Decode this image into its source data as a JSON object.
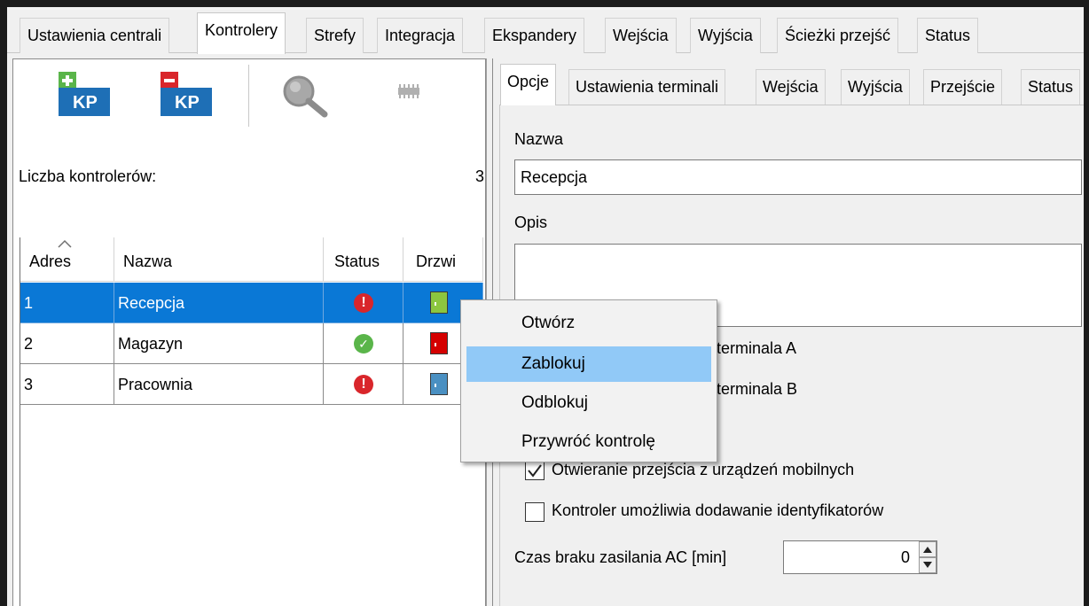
{
  "main_tabs": [
    {
      "label": "Ustawienia centrali"
    },
    {
      "label": "Kontrolery",
      "active": true
    },
    {
      "label": "Strefy"
    },
    {
      "label": "Integracja"
    },
    {
      "label": "Ekspandery"
    },
    {
      "label": "Wejścia"
    },
    {
      "label": "Wyjścia"
    },
    {
      "label": "Ścieżki przejść"
    },
    {
      "label": "Status"
    }
  ],
  "toolbar": {
    "add_icon_text": "KP",
    "remove_icon_text": "KP",
    "add_icon": "add-keypad-icon",
    "remove_icon": "remove-keypad-icon",
    "search_icon": "search-icon",
    "device_icon": "device-module-icon",
    "add_color": "#5ab54a",
    "remove_color": "#d9262b",
    "kp_color": "#1e6fb6"
  },
  "controllers": {
    "count_label": "Liczba kontrolerów:",
    "count_value": "3",
    "columns": [
      "Adres",
      "Nazwa",
      "Status",
      "Drzwi"
    ],
    "rows": [
      {
        "address": "1",
        "name": "Recepcja",
        "status": "error",
        "door": "green",
        "selected": true
      },
      {
        "address": "2",
        "name": "Magazyn",
        "status": "ok",
        "door": "red"
      },
      {
        "address": "3",
        "name": "Pracownia",
        "status": "error",
        "door": "blue"
      }
    ]
  },
  "status_glyphs": {
    "error": "!",
    "ok": "✓"
  },
  "colors": {
    "selection": "#0a78d6",
    "door_green": "#8cc63f",
    "door_red": "#d40000",
    "door_blue": "#4a90c2",
    "status_error": "#d9262b",
    "status_ok": "#5ab54a"
  },
  "sub_tabs": [
    {
      "label": "Opcje",
      "active": true
    },
    {
      "label": "Ustawienia terminali"
    },
    {
      "label": "Wejścia"
    },
    {
      "label": "Wyjścia"
    },
    {
      "label": "Przejście"
    },
    {
      "label": "Status"
    }
  ],
  "options": {
    "name_label": "Nazwa",
    "name_value": "Recepcja",
    "desc_label": "Opis",
    "desc_value": "",
    "terminal_a_tail": "terminala A",
    "terminal_b_tail": "terminala B",
    "mobile_label": "Otwieranie przejścia z urządzeń mobilnych",
    "mobile_checked": true,
    "ids_label": "Kontroler umożliwia dodawanie identyfikatorów",
    "ids_checked": false,
    "ac_label": "Czas braku zasilania AC [min]",
    "ac_value": "0"
  },
  "context_menu": {
    "items": [
      {
        "label": "Otwórz"
      },
      {
        "label": "Zablokuj",
        "highlighted": true
      },
      {
        "label": "Odblokuj"
      },
      {
        "label": "Przywróć kontrolę"
      }
    ]
  }
}
